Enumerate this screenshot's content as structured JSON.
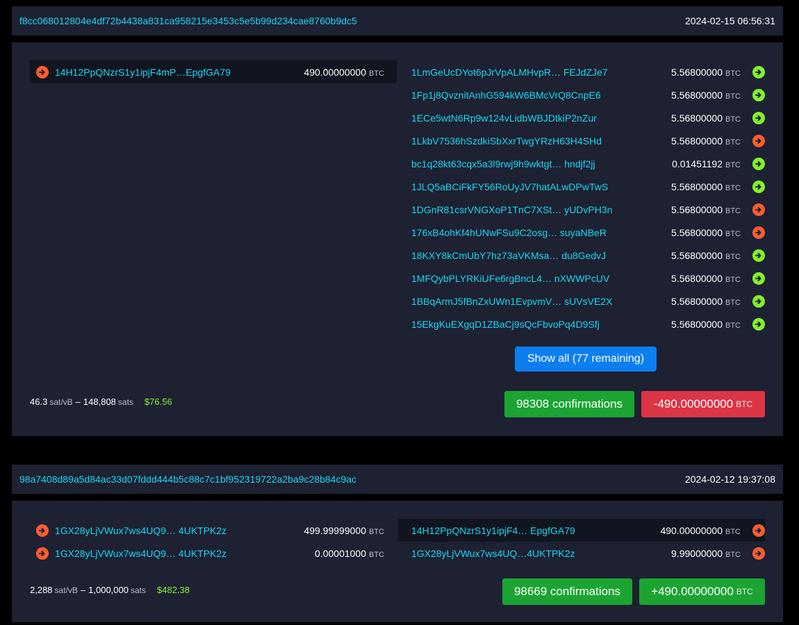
{
  "colors": {
    "background": "#000000",
    "panel": "#1d2132",
    "link": "#1bd8f4",
    "spent_icon": "#fd5c2d",
    "unspent_icon": "#84f02c",
    "confirm_badge": "#1ca433",
    "negative_badge": "#dc3545",
    "show_all_button": "#0d7ef0"
  },
  "unit": "BTC",
  "tx1": {
    "txid": "f8cc068012804e4df72b4438a831ca958215e3453c5e5b99d234cae8760b9dc5",
    "timestamp": "2024-02-15 06:56:31",
    "inputs": [
      {
        "address": "14H12PpQNzrS1y1ipjF4mP…EpgfGA79",
        "amount": "490.00000000",
        "icon": "arrow-right-circle-icon",
        "state": "spent"
      }
    ],
    "outputs": [
      {
        "address": "1LmGeUcDYot6pJrVpALMHvpR…  FEJdZJe7",
        "amount": "5.56800000",
        "state": "unspent"
      },
      {
        "address": "1Fp1j8QvznitAnhG594kW6BMcVrQ8CnpE6",
        "amount": "5.56800000",
        "state": "unspent"
      },
      {
        "address": "1ECe5wtN6Rp9w124vLidbWBJDtkiP2nZur",
        "amount": "5.56800000",
        "state": "unspent"
      },
      {
        "address": "1LkbV7536hSzdkiSbXxrTwgYRzH63H4SHd",
        "amount": "5.56800000",
        "state": "spent"
      },
      {
        "address": "bc1q28kt63cqx5a3l9rwj9h9wktgt…  hndjf2jj",
        "amount": "0.01451192",
        "state": "unspent"
      },
      {
        "address": "1JLQ5aBCiFkFY56RoUyJV7hatALwDPwTwS",
        "amount": "5.56800000",
        "state": "unspent"
      },
      {
        "address": "1DGnR81csrVNGXoP1TnC7XSt…  yUDvPH3n",
        "amount": "5.56800000",
        "state": "spent"
      },
      {
        "address": "176xB4ohKf4hUNwFSu9C2osg…  suyaNBeR",
        "amount": "5.56800000",
        "state": "spent"
      },
      {
        "address": "18KXY8kCmUbY7hz73aVKMsa…  du8GedvJ",
        "amount": "5.56800000",
        "state": "unspent"
      },
      {
        "address": "1MFQybPLYRKiUFe6rgBncL4… nXWWPcUV",
        "amount": "5.56800000",
        "state": "unspent"
      },
      {
        "address": "1BBqArmJ5fBnZxUWn1EvpvmV… sUVsVE2X",
        "amount": "5.56800000",
        "state": "unspent"
      },
      {
        "address": "15EkgKuEXgqD1ZBaCj9sQcFbvoPq4D9Sfj",
        "amount": "5.56800000",
        "state": "unspent"
      }
    ],
    "show_all_label": "Show all (77 remaining)",
    "fee_rate": "46.3",
    "fee_rate_unit": "sat/vB",
    "fee_sep": "–",
    "fee_sats": "148,808",
    "fee_sats_unit": "sats",
    "fee_usd": "$76.56",
    "confirmations": "98308 confirmations",
    "delta": "-490.00000000"
  },
  "tx2": {
    "txid": "98a7408d89a5d84ac33d07fddd444b5c88c7c1bf952319722a2ba9c28b84c9ac",
    "timestamp": "2024-02-12 19:37:08",
    "inputs": [
      {
        "address": "1GX28yLjVWux7ws4UQ9…  4UKTPK2z",
        "amount": "499.99999000",
        "state": "spent"
      },
      {
        "address": "1GX28yLjVWux7ws4UQ9…  4UKTPK2z",
        "amount": "0.00001000",
        "state": "spent"
      }
    ],
    "outputs": [
      {
        "address": "14H12PpQNzrS1y1ipjF4…  EpgfGA79",
        "amount": "490.00000000",
        "state": "spent"
      },
      {
        "address": "1GX28yLjVWux7ws4UQ…4UKTPK2z",
        "amount": "9.99000000",
        "state": "spent"
      }
    ],
    "fee_rate": "2,288",
    "fee_rate_unit": "sat/vB",
    "fee_sep": "–",
    "fee_sats": "1,000,000",
    "fee_sats_unit": "sats",
    "fee_usd": "$482.38",
    "confirmations": "98669 confirmations",
    "delta": "+490.00000000"
  }
}
